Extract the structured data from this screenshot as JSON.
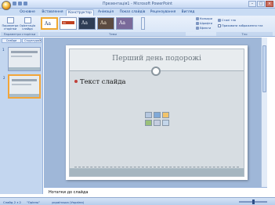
{
  "window": {
    "title": "Презентація1 - Microsoft PowerPoint",
    "minimize": "–",
    "maximize": "□",
    "close": "×"
  },
  "tabs": [
    "Основне",
    "Вставлення",
    "Конструктор",
    "Анімація",
    "Показ слайдів",
    "Рецензування",
    "Вигляд"
  ],
  "active_tab": "Конструктор",
  "ribbon": {
    "page_setup": {
      "btn1": "Параметри сторінки",
      "btn2": "Орієнтація слайда",
      "group": "Параметри сторінки"
    },
    "themes": {
      "sample": "Aa",
      "group": "Теми"
    },
    "theme_options": {
      "colors": "Кольори",
      "fonts": "Шрифти",
      "effects": "Ефекти"
    },
    "background": {
      "styles": "Стилі тла",
      "hide": "Приховати зображення тла",
      "group": "Тло"
    }
  },
  "slides_pane": {
    "tab1": "Слайди",
    "tab2": "Структура",
    "close": "×",
    "slide_numbers": [
      "1",
      "2"
    ]
  },
  "slide": {
    "title": "Перший день подорожі",
    "bullet": "Текст слайда"
  },
  "notes": {
    "text": "Нотатки до слайда"
  },
  "status": {
    "slide_info": "Слайд 2 з 2",
    "theme": "\"Оріель\"",
    "language": "українська (Україна)"
  },
  "colors": {
    "ribbon": "#d6e4f6",
    "workspace": "#9fb7d8",
    "bullet": "#c0413b",
    "selection": "#f2a53a"
  }
}
